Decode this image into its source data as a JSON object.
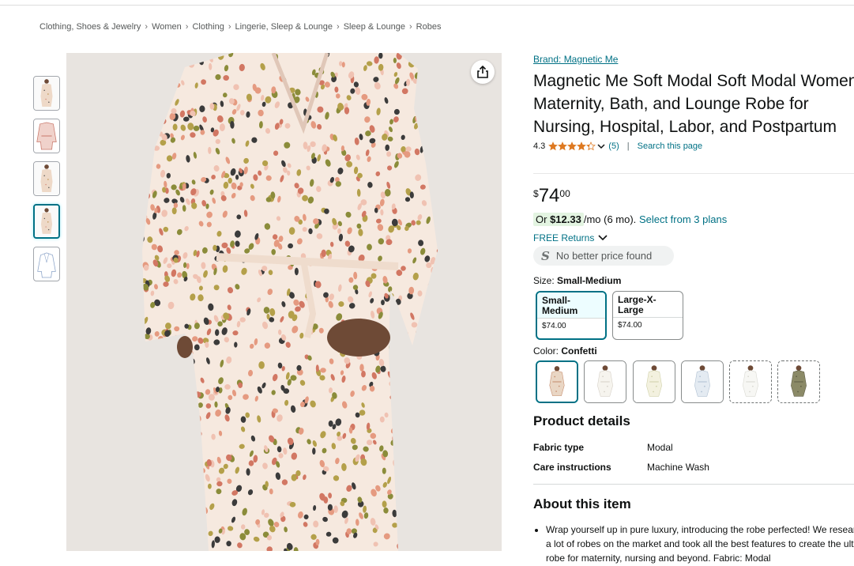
{
  "breadcrumb": [
    "Clothing, Shoes & Jewelry",
    "Women",
    "Clothing",
    "Lingerie, Sleep & Lounge",
    "Sleep & Lounge",
    "Robes"
  ],
  "breadcrumb_separator": "›",
  "thumbnails": [
    {
      "name": "thumbnail-1",
      "kind": "robe-front"
    },
    {
      "name": "thumbnail-2",
      "kind": "robe-flat-pink"
    },
    {
      "name": "thumbnail-3",
      "kind": "robe-model"
    },
    {
      "name": "thumbnail-4",
      "kind": "robe-closeup",
      "selected": true
    },
    {
      "name": "thumbnail-5",
      "kind": "robe-sketch"
    }
  ],
  "product": {
    "brand": "Brand: Magnetic Me",
    "title": "Magnetic Me Soft Modal Soft Modal Women's Maternity, Bath, and Lounge Robe for Nursing, Hospital, Labor, and Postpartum",
    "rating": "4.3",
    "stars": 4.3,
    "rating_count": "(5)",
    "separator": "|",
    "search_page": "Search this page",
    "price_symbol": "$",
    "price_whole": "74",
    "price_fraction": "00",
    "monthly_prefix": "Or",
    "monthly_amount": "$12.33",
    "monthly_suffix": "/mo (6 mo).",
    "monthly_plans": "Select from 3 plans",
    "returns": "FREE Returns",
    "no_better_price_icon": "S",
    "no_better_price": "No better price found"
  },
  "size": {
    "label": "Size:",
    "selected": "Small-Medium",
    "options": [
      {
        "name": "Small-\nMedium",
        "price": "$74.00",
        "selected": true
      },
      {
        "name": "Large-X-\nLarge",
        "price": "$74.00",
        "selected": false
      }
    ]
  },
  "color": {
    "label": "Color:",
    "selected": "Confetti",
    "swatches": [
      {
        "name": "confetti",
        "robe": "#e9d6c4",
        "dot": "#c48a6a",
        "selected": true,
        "dashed": false
      },
      {
        "name": "white-1",
        "robe": "#f6f4ee",
        "dot": "#d5d0c7",
        "selected": false,
        "dashed": false
      },
      {
        "name": "cream",
        "robe": "#f3f1df",
        "dot": "#cfd0a8",
        "selected": false,
        "dashed": false
      },
      {
        "name": "light-blue",
        "robe": "#e4ebf2",
        "dot": "#aebfd1",
        "selected": false,
        "dashed": false
      },
      {
        "name": "white-2",
        "robe": "#f7f7f4",
        "dot": "#d7d7d0",
        "selected": false,
        "dashed": true
      },
      {
        "name": "olive",
        "robe": "#8b8a67",
        "dot": "#5d5c44",
        "selected": false,
        "dashed": true
      }
    ]
  },
  "details": {
    "title": "Product details",
    "rows": [
      {
        "key": "Fabric type",
        "value": "Modal"
      },
      {
        "key": "Care instructions",
        "value": "Machine Wash"
      }
    ]
  },
  "about": {
    "title": "About this item",
    "bullets": [
      "Wrap yourself up in pure luxury, introducing the robe perfected! We researched a lot of robes on the market and took all the best features to create the ultimate robe for maternity, nursing and beyond. Fabric: Modal"
    ]
  },
  "colors": {
    "link": "#007185",
    "selected_border": "#007185",
    "star": "#de7921",
    "price_badge": "#e3f4e1"
  },
  "icons": {
    "share": "share-icon",
    "chevron": "chevron-down-icon",
    "star": "star-icon"
  }
}
